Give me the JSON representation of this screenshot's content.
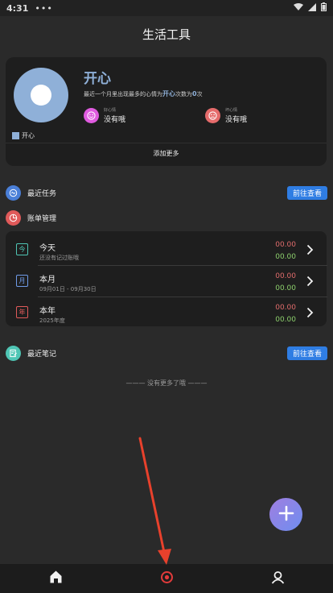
{
  "status_bar": {
    "time": "4:31",
    "dots": "•••"
  },
  "app_bar": {
    "title": "生活工具"
  },
  "mood_card": {
    "mood": "开心",
    "legend_label": "开心",
    "summary_prefix": "最近一个月里出现最多的心情为",
    "summary_mood": "开心",
    "summary_mid": "次数为",
    "summary_count": "0",
    "summary_suffix": "次",
    "good": {
      "label": "好心情",
      "value": "没有哦",
      "color": "#e05be0"
    },
    "bad": {
      "label": "坏心情",
      "value": "没有哦",
      "color": "#e56b6b"
    },
    "add_more": "添加更多",
    "chart_color": "#8fb0d8"
  },
  "recent_tasks": {
    "title": "最近任务",
    "button": "前往查看",
    "icon_color": "#4a7fd8"
  },
  "bill_manage": {
    "title": "账单管理",
    "icon_color": "#e05a5a",
    "rows": [
      {
        "badge": "今",
        "name": "今天",
        "desc": "还没有记过账哦",
        "expense": "00.00",
        "income": "00.00",
        "badge_color": "#4fc6b5"
      },
      {
        "badge": "月",
        "name": "本月",
        "desc": "09月01日 - 09月30日",
        "expense": "00.00",
        "income": "00.00",
        "badge_color": "#6f9be8"
      },
      {
        "badge": "年",
        "name": "本年",
        "desc": "2025年度",
        "expense": "00.00",
        "income": "00.00",
        "badge_color": "#e05a5a"
      }
    ]
  },
  "recent_notes": {
    "title": "最近笔记",
    "button": "前往查看",
    "icon_color": "#4fc6b5"
  },
  "no_more": "——— 没有更多了哦 ———",
  "colors": {
    "accent": "#2f7de3",
    "nav_active": "#e23b3b",
    "arrow": "#e8412c"
  },
  "icons": {
    "fab": "plus-icon",
    "nav": [
      "home-icon",
      "explore-icon",
      "profile-icon"
    ]
  }
}
